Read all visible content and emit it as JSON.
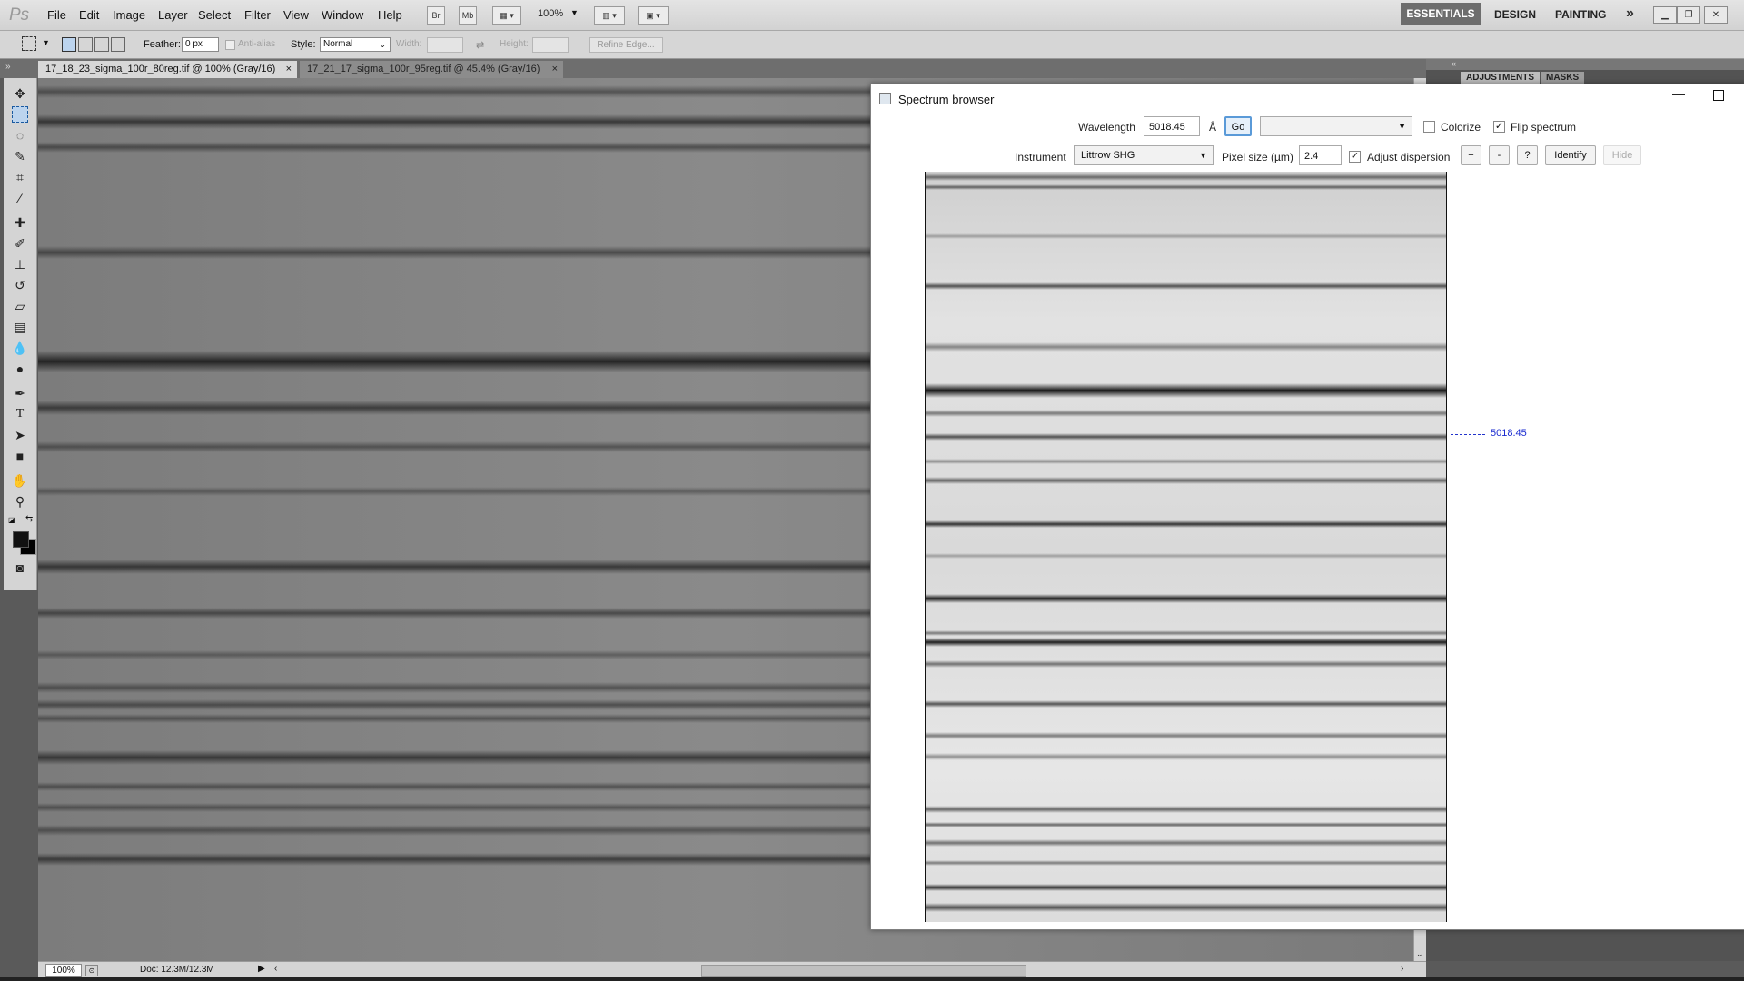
{
  "app": {
    "logo": "Ps"
  },
  "menu": [
    "File",
    "Edit",
    "Image",
    "Layer",
    "Select",
    "Filter",
    "View",
    "Window",
    "Help"
  ],
  "app_bar": {
    "bridge": "Br",
    "mini_bridge": "Mb",
    "zoom": "100%"
  },
  "workspaces": [
    "ESSENTIALS",
    "DESIGN",
    "PAINTING"
  ],
  "options": {
    "feather_label": "Feather:",
    "feather_value": "0 px",
    "anti_alias_label": "Anti-alias",
    "style_label": "Style:",
    "style_value": "Normal",
    "width_label": "Width:",
    "height_label": "Height:",
    "refine_edge": "Refine Edge..."
  },
  "tabs": [
    {
      "label": "17_18_23_sigma_100r_80reg.tif @ 100% (Gray/16)",
      "close": "×"
    },
    {
      "label": "17_21_17_sigma_100r_95reg.tif @ 45.4% (Gray/16)",
      "close": "×"
    }
  ],
  "panels": {
    "adjustments": "ADJUSTMENTS",
    "masks": "MASKS"
  },
  "status": {
    "zoom": "100%",
    "doc": "Doc: 12.3M/12.3M"
  },
  "spectrum_browser": {
    "title": "Spectrum browser",
    "wavelength_label": "Wavelength",
    "wavelength_value": "5018.45",
    "unit": "Å",
    "go": "Go",
    "line_select_value": "",
    "colorize_label": "Colorize",
    "colorize_checked": false,
    "flip_label": "Flip spectrum",
    "flip_checked": true,
    "instrument_label": "Instrument",
    "instrument_value": "Littrow SHG",
    "pixel_size_label": "Pixel size (µm)",
    "pixel_size_value": "2.4",
    "adjust_dispersion_label": "Adjust dispersion",
    "adjust_dispersion_checked": true,
    "plus": "+",
    "minus": "-",
    "help": "?",
    "identify": "Identify",
    "hide": "Hide",
    "marker_label": "5018.45"
  }
}
